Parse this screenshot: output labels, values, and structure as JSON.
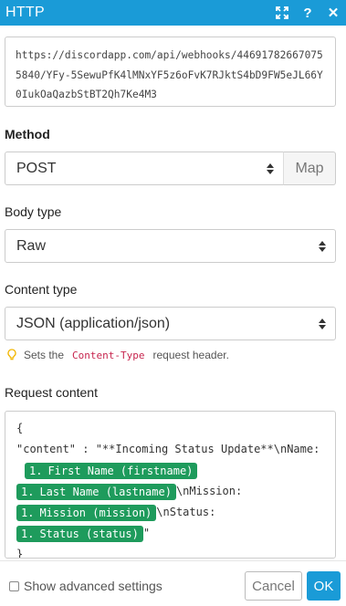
{
  "window": {
    "title": "HTTP",
    "expand_icon": "expand-icon",
    "help_label": "?",
    "close_label": "✕"
  },
  "url": {
    "value": "https://discordapp.com/api/webhooks/446917826670755840/YFy-5SewuPfK4lMNxYF5z6oFvK7RJktS4bD9FW5eJL66Y0IukOaQazbStBT2Qh7Ke4M3"
  },
  "method": {
    "label": "Method",
    "value": "POST",
    "map_label": "Map"
  },
  "body_type": {
    "label": "Body type",
    "value": "Raw"
  },
  "content_type": {
    "label": "Content type",
    "value": "JSON (application/json)",
    "hint_prefix": "Sets the",
    "hint_code": "Content-Type",
    "hint_suffix": "request header."
  },
  "request_content": {
    "label": "Request content",
    "line1": "{",
    "line2": "\"content\" : \"**Incoming Status Update**\\nName:",
    "pill_firstname_num": "1.",
    "pill_firstname": "First Name (firstname)",
    "pill_lastname_num": "1.",
    "pill_lastname": "Last Name (lastname)",
    "after_lastname": "\\nMission:",
    "pill_mission_num": "1.",
    "pill_mission": "Mission (mission)",
    "after_mission": "\\nStatus:",
    "pill_status_num": "1.",
    "pill_status": "Status (status)",
    "after_status": "\"",
    "line_close": "}"
  },
  "footer": {
    "advanced_label": "Show advanced settings",
    "advanced_checked": false,
    "cancel_label": "Cancel",
    "ok_label": "OK"
  },
  "colors": {
    "accent": "#1a9bd7",
    "pill": "#1e9b5c",
    "code": "#c7254e"
  }
}
